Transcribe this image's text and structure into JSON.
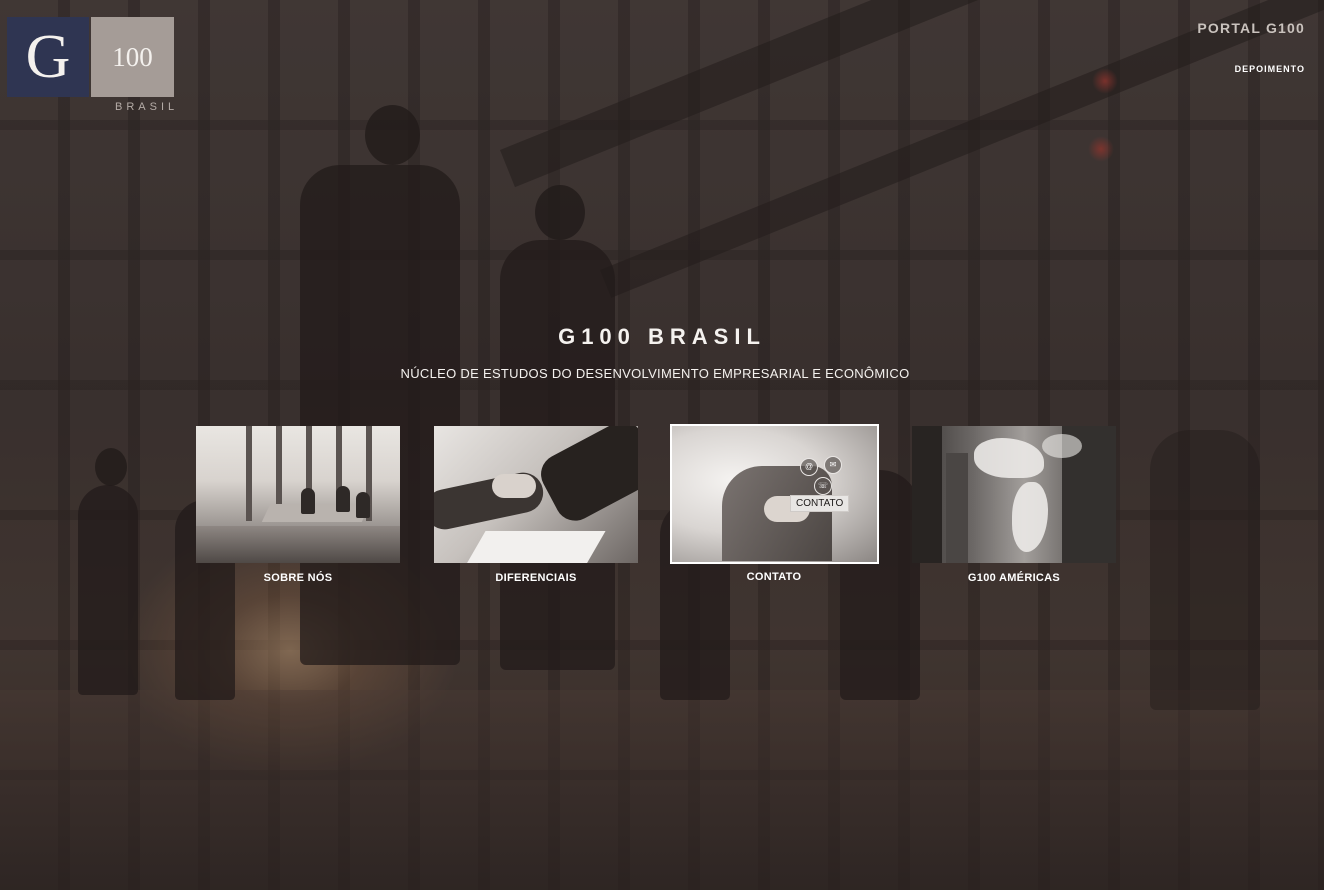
{
  "logo": {
    "letter": "G",
    "number": "100",
    "country": "BRASIL"
  },
  "nav": {
    "portal": "PORTAL G100",
    "depoimento": "DEPOIMENTO"
  },
  "hero": {
    "title": "G100 BRASIL",
    "subtitle": "NÚCLEO DE ESTUDOS DO DESENVOLVIMENTO EMPRESARIAL E ECONÔMICO"
  },
  "cards": [
    {
      "label": "SOBRE NÓS",
      "image": "meeting-room-photo"
    },
    {
      "label": "DIFERENCIAIS",
      "image": "handshake-photo"
    },
    {
      "label": "CONTATO",
      "image": "contact-photo",
      "overlay_tag": "CONTATO",
      "active": true,
      "icons": [
        "at-sign-icon",
        "envelope-icon",
        "phone-icon"
      ]
    },
    {
      "label": "G100 AMÉRICAS",
      "image": "world-map-photo"
    }
  ],
  "colors": {
    "logo_navy": "#2f3552",
    "logo_taupe": "#a59c97",
    "text": "#ffffff",
    "background": "#3d3431"
  }
}
